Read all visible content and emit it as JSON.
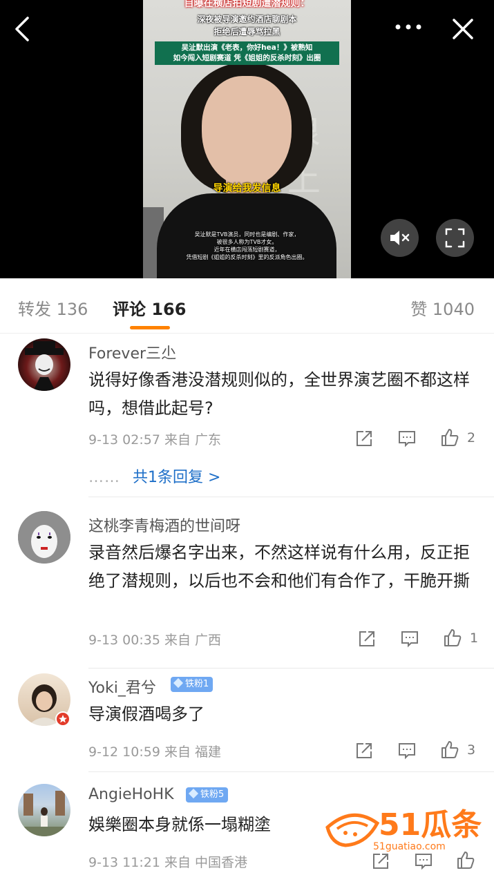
{
  "video": {
    "caption_top_1": "自曝在横店拍短剧遭潜规则：",
    "caption_top_2": "深夜被导演邀约酒店聊剧本",
    "caption_top_3": "拒绝后遭辱骂拉黑",
    "green_box_line1": "吴沚默出演《老表，你好hea！》被熟知",
    "green_box_line2": "如今闯入短剧赛道 凭《姐姐的反杀时刻》出圈",
    "subtitle": "导演给我发信息",
    "info_line1": "吴沚默是TVB演员，同时也是编剧、作家，",
    "info_line2": "被很多人称为TVB才女。",
    "info_line3": "近年在横店闯荡短剧赛道，",
    "info_line4": "凭借短剧《姐姐的反杀时刻》里的反派角色出圈。",
    "wall_mark": "浪上涨"
  },
  "tabs": {
    "repost": "转发 136",
    "comment": "评论 166",
    "like": "赞 1040"
  },
  "comments": [
    {
      "name": "Forever三尐",
      "text": "说得好像香港没潜规则似的，全世界演艺圈不都这样吗，想借此起号?",
      "meta": "9-13 02:57  来自 广东",
      "likes": "2",
      "replies": "共1条回复 >",
      "reply_dots": "……"
    },
    {
      "name": "这桃李青梅酒的世间呀",
      "text": "录音然后爆名字出来，不然这样说有什么用，反正拒绝了潜规则，以后也不会和他们有合作了，干脆开撕",
      "meta": "9-13 00:35  来自 广西",
      "likes": "1"
    },
    {
      "name": "Yoki_君兮",
      "badge": "铁粉1",
      "text": "导演假酒喝多了",
      "meta": "9-12 10:59  来自 福建",
      "likes": "3"
    },
    {
      "name": "AngieHoHK",
      "badge": "铁粉5",
      "text": "娛樂圈本身就係一塌糊塗",
      "meta": "9-13 11:21  来自 中国香港"
    }
  ],
  "watermark": {
    "brand": "51瓜条",
    "site": "51guatiao.com"
  },
  "colors": {
    "accent": "#ff8200",
    "link": "#1e6fc8",
    "badge": "#6fa8f2"
  }
}
